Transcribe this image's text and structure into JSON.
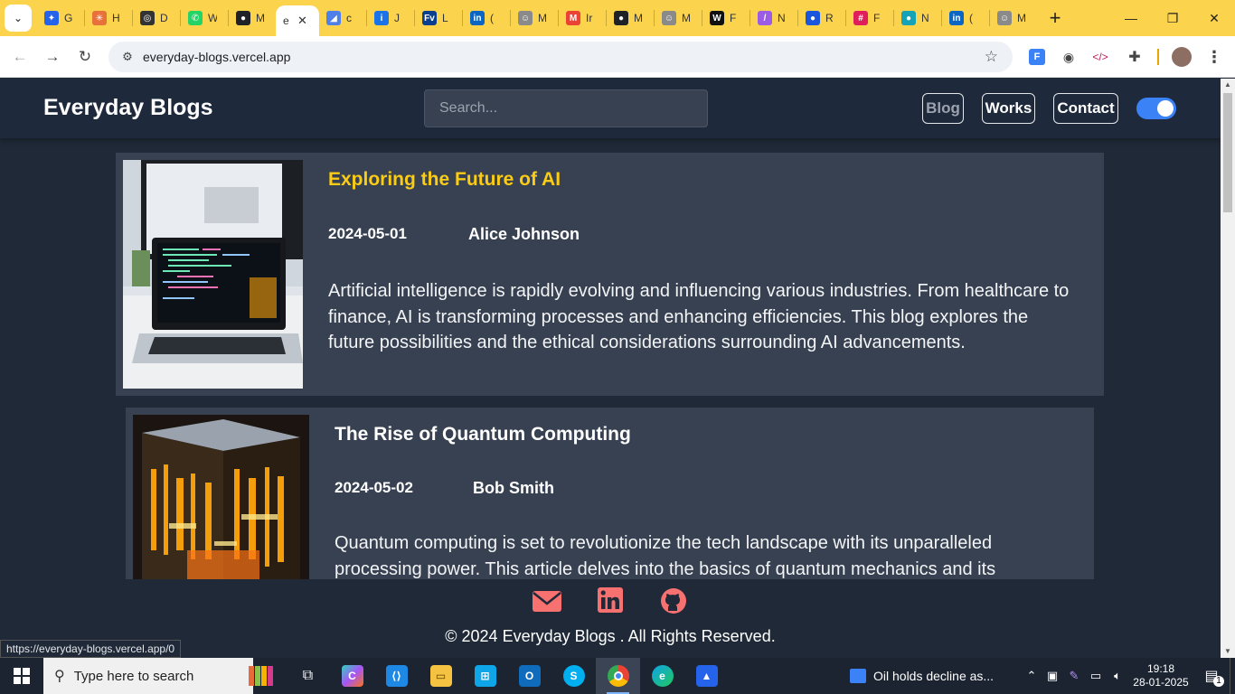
{
  "browser": {
    "tabs": [
      {
        "label": "G",
        "color": "#2563eb",
        "glyph": "✦"
      },
      {
        "label": "H",
        "color": "#e8703a",
        "glyph": "✳"
      },
      {
        "label": "D",
        "color": "#333333",
        "glyph": "◎"
      },
      {
        "label": "W",
        "color": "#25d366",
        "glyph": "✆"
      },
      {
        "label": "M",
        "color": "#1f2328",
        "glyph": "●"
      },
      {
        "label": "e",
        "color": "#ffffff",
        "glyph": "",
        "active": true
      },
      {
        "label": "c",
        "color": "#4f7fe8",
        "glyph": "◢"
      },
      {
        "label": "J",
        "color": "#1a73e8",
        "glyph": "i"
      },
      {
        "label": "L",
        "color": "#0a3f8f",
        "glyph": "Fv"
      },
      {
        "label": "(",
        "color": "#0a66c2",
        "glyph": "in"
      },
      {
        "label": "M",
        "color": "#8a8a8a",
        "glyph": "☺"
      },
      {
        "label": "Ir",
        "color": "#ea4335",
        "glyph": "M"
      },
      {
        "label": "M",
        "color": "#1f2328",
        "glyph": "●"
      },
      {
        "label": "M",
        "color": "#8a8a8a",
        "glyph": "☺"
      },
      {
        "label": "F",
        "color": "#111111",
        "glyph": "W"
      },
      {
        "label": "N",
        "color": "#9b5de5",
        "glyph": "/"
      },
      {
        "label": "R",
        "color": "#1a56db",
        "glyph": "●"
      },
      {
        "label": "F",
        "color": "#e01e5a",
        "glyph": "#"
      },
      {
        "label": "N",
        "color": "#16a3b8",
        "glyph": "●"
      },
      {
        "label": "(",
        "color": "#0a66c2",
        "glyph": "in"
      },
      {
        "label": "M",
        "color": "#8a8a8a",
        "glyph": "☺"
      }
    ],
    "url": "everyday-blogs.vercel.app",
    "status_url": "https://everyday-blogs.vercel.app/0"
  },
  "site": {
    "brand": "Everyday Blogs",
    "search_placeholder": "Search...",
    "nav": {
      "blog": "Blog",
      "works": "Works",
      "contact": "Contact"
    },
    "theme_toggle_on": true,
    "posts": [
      {
        "title": "Exploring the Future of AI",
        "title_color": "#facc15",
        "date": "2024-05-01",
        "author": "Alice Johnson",
        "excerpt": "Artificial intelligence is rapidly evolving and influencing various industries. From healthcare to finance, AI is transforming processes and enhancing efficiencies. This blog explores the future possibilities and the ethical considerations surrounding AI advancements."
      },
      {
        "title": "The Rise of Quantum Computing",
        "title_color": "#ffffff",
        "date": "2024-05-02",
        "author": "Bob Smith",
        "excerpt": "Quantum computing is set to revolutionize the tech landscape with its unparalleled processing power. This article delves into the basics of quantum mechanics and its"
      }
    ],
    "footer": {
      "icons": [
        "mail-icon",
        "linkedin-icon",
        "github-icon"
      ],
      "icon_color": "#f87171",
      "copyright": "© 2024 Everyday Blogs . All Rights Reserved."
    }
  },
  "taskbar": {
    "search_placeholder": "Type here to search",
    "weather_text": "Oil holds decline as...",
    "time": "19:18",
    "date": "28-01-2025",
    "notification_count": "1"
  }
}
